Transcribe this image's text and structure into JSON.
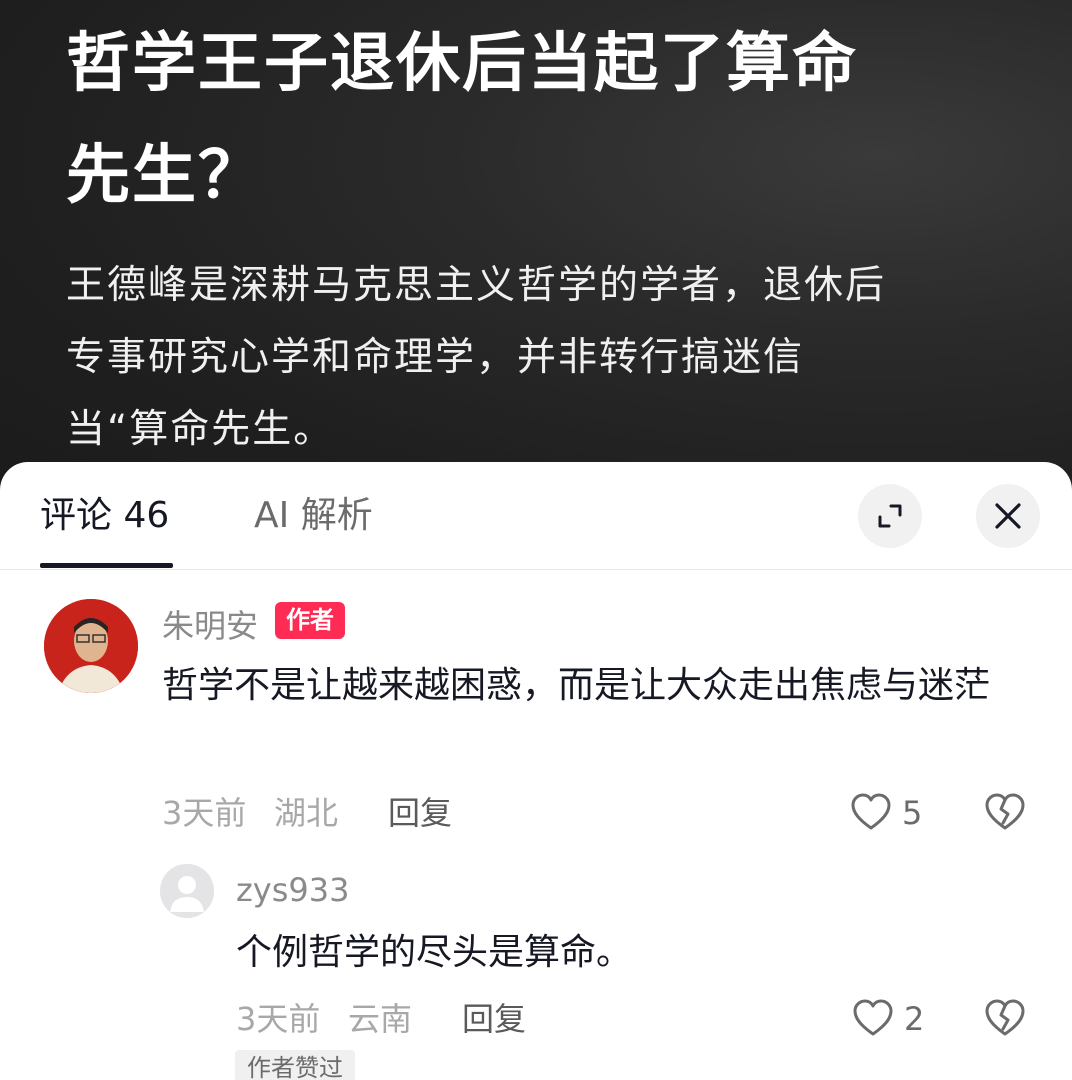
{
  "post": {
    "title": "哲学王子退休后当起了算命先生？",
    "description": "王德峰是深耕马克思主义哲学的学者，退休后专事研究心学和命理学，并非转行搞迷信当“算命先生。"
  },
  "tabs": {
    "comments_label": "评论 46",
    "ai_label": "AI 解析"
  },
  "comments": [
    {
      "author": "朱明安",
      "author_tag": "作者",
      "text": "哲学不是让越来越困惑，而是让大众走出焦虑与迷茫",
      "time": "3天前",
      "location": "湖北",
      "reply_label": "回复",
      "likes": "5",
      "replies": [
        {
          "author": "zys933",
          "text": "个例哲学的尽头是算命。",
          "time": "3天前",
          "location": "云南",
          "reply_label": "回复",
          "likes": "2",
          "badge": "作者赞过"
        }
      ]
    }
  ],
  "icons": {
    "expand": "expand-icon",
    "close": "close-icon",
    "like": "heart-icon",
    "dislike": "broken-heart-icon"
  },
  "colors": {
    "accent": "#fe2c55",
    "text": "#161823",
    "muted": "#a8a8a8"
  }
}
